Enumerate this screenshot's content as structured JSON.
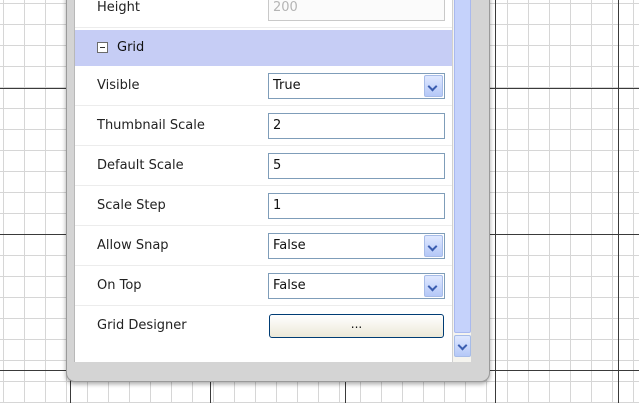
{
  "properties": {
    "height_row": {
      "label": "Height",
      "value": "200"
    },
    "grid_category": {
      "label": "Grid",
      "expanded": true
    },
    "rows": [
      {
        "label": "Visible",
        "value": "True",
        "editor": "dropdown"
      },
      {
        "label": "Thumbnail Scale",
        "value": "2",
        "editor": "text"
      },
      {
        "label": "Default Scale",
        "value": "5",
        "editor": "text"
      },
      {
        "label": "Scale Step",
        "value": "1",
        "editor": "text"
      },
      {
        "label": "Allow Snap",
        "value": "False",
        "editor": "dropdown"
      },
      {
        "label": "On Top",
        "value": "False",
        "editor": "dropdown"
      },
      {
        "label": "Grid Designer",
        "value": "...",
        "editor": "button"
      }
    ]
  },
  "colors": {
    "category_header": "#c6cdf5",
    "scroll_thumb": "#c5d2fb",
    "canvas_grid": "#d6d6d6",
    "canvas_major_grid": "#3a3a3a"
  },
  "icons": {
    "collapse_toggle": "minus-box-icon",
    "dropdown": "chevron-down-icon",
    "scroll_down": "chevron-down-icon"
  }
}
